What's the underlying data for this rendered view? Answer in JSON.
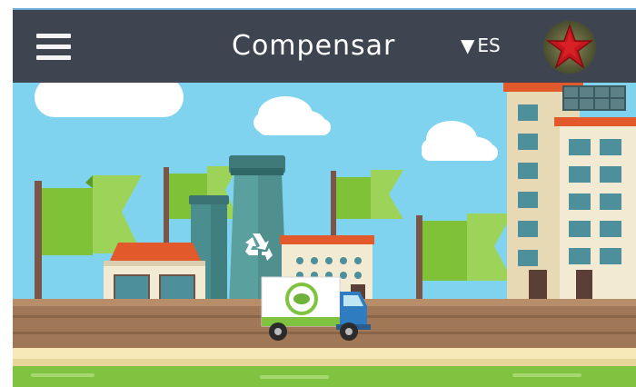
{
  "header": {
    "title": "Compensar",
    "language": "ES",
    "menu_icon": "hamburger-menu-icon",
    "avatar_icon": "user-avatar-star-icon"
  },
  "banner": {
    "illustration": "city-eco-scene",
    "recycle_icon": "recycle-icon",
    "truck_logo_icon": "leaf-icon"
  },
  "colors": {
    "topbar": "#3e4450",
    "sky": "#7fd3ee",
    "road": "#a07857",
    "grass": "#7fc341",
    "flag_green": "#86c13f",
    "factory": "#4f8f8e",
    "roof_red": "#e05a2b"
  }
}
